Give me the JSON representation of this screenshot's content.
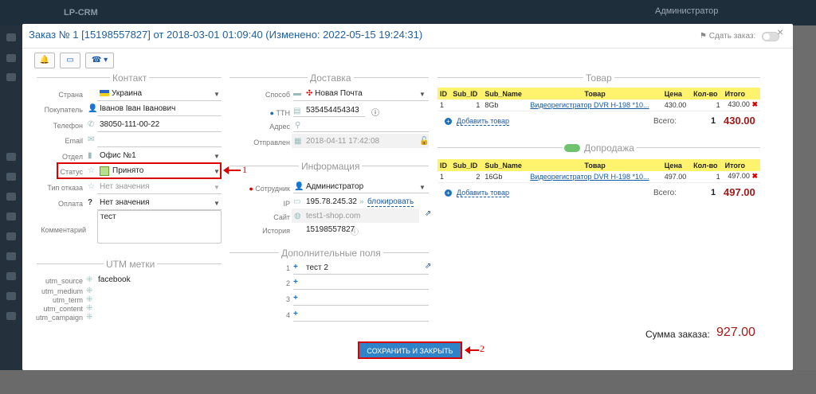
{
  "background": {
    "logo": "LP-CRM",
    "admin": "Администратор"
  },
  "modal": {
    "title": "Заказ № 1 [15198557827] от 2018-03-01 01:09:40 (Изменено: 2022-05-15 19:24:31)",
    "send_order_label": "Сдать заказ:",
    "close": "×"
  },
  "toolbar": {
    "bell": "🔔",
    "window": "▭",
    "phone": "☎ ▾"
  },
  "contact": {
    "title": "Контакт",
    "country_label": "Страна",
    "country": "Украина",
    "buyer_label": "Покупатель",
    "buyer": "Іванов Іван Іванович",
    "phone_label": "Телефон",
    "phone": "38050-111-00-22",
    "email_label": "Email",
    "dept_label": "Отдел",
    "dept": "Офис №1",
    "status_label": "Статус",
    "status": "Принято",
    "refusal_label": "Тип отказа",
    "refusal": "Нет значения",
    "payment_label": "Оплата",
    "payment": "Нет значения",
    "comment_label": "Комментарий",
    "comment": "тест"
  },
  "delivery": {
    "title": "Доставка",
    "method_label": "Способ",
    "method": "Новая Почта",
    "ttn_label": "ТТН",
    "ttn": "535454454343",
    "address_label": "Адрес",
    "sent_label": "Отправлен",
    "sent": "2018-04-11 17:42:08"
  },
  "info": {
    "title": "Информация",
    "employee_label": "Сотрудник",
    "employee": "Администратор",
    "ip_label": "IP",
    "ip": "195.78.245.32",
    "block": "блокировать",
    "site_label": "Сайт",
    "site": "test1-shop.com",
    "history_label": "История",
    "history": "15198557827"
  },
  "extra": {
    "title": "Дополнительные поля",
    "rows": [
      {
        "n": "1",
        "v": "тест 2"
      },
      {
        "n": "2",
        "v": ""
      },
      {
        "n": "3",
        "v": ""
      },
      {
        "n": "4",
        "v": ""
      }
    ]
  },
  "utm": {
    "title": "UTM метки",
    "rows": [
      {
        "k": "utm_source",
        "v": "facebook"
      },
      {
        "k": "utm_medium",
        "v": ""
      },
      {
        "k": "utm_term",
        "v": ""
      },
      {
        "k": "utm_content",
        "v": ""
      },
      {
        "k": "utm_campaign",
        "v": ""
      }
    ]
  },
  "goods": {
    "title": "Товар",
    "headers": [
      "ID",
      "Sub_ID",
      "Sub_Name",
      "Товар",
      "Цена",
      "Кол-во",
      "Итого"
    ],
    "row": {
      "id": "1",
      "sub_id": "1",
      "sub_name": "8Gb",
      "item": "Видеорегистратор DVR H-198 *10...",
      "price": "430.00",
      "qty": "1",
      "total": "430.00"
    },
    "add": "Добавить товар",
    "sum_label": "Всего:",
    "sum_qty": "1",
    "sum_total": "430.00"
  },
  "upsell": {
    "title": "Допродажа",
    "headers": [
      "ID",
      "Sub_ID",
      "Sub_Name",
      "Товар",
      "Цена",
      "Кол-во",
      "Итого"
    ],
    "row": {
      "id": "1",
      "sub_id": "2",
      "sub_name": "16Gb",
      "item": "Видеорегистратор DVR H-198 *10...",
      "price": "497.00",
      "qty": "1",
      "total": "497.00"
    },
    "add": "Добавить товар",
    "sum_label": "Всего:",
    "sum_qty": "1",
    "sum_total": "497.00"
  },
  "order_total": {
    "label": "Сумма заказа:",
    "value": "927.00"
  },
  "save_button": "СОХРАНИТЬ И ЗАКРЫТЬ",
  "annotations": {
    "a1": "1",
    "a2": "2"
  },
  "colors": {
    "accent": "#1f5f9c",
    "header_yellow": "#fff36e",
    "marker_red": "#d00"
  }
}
